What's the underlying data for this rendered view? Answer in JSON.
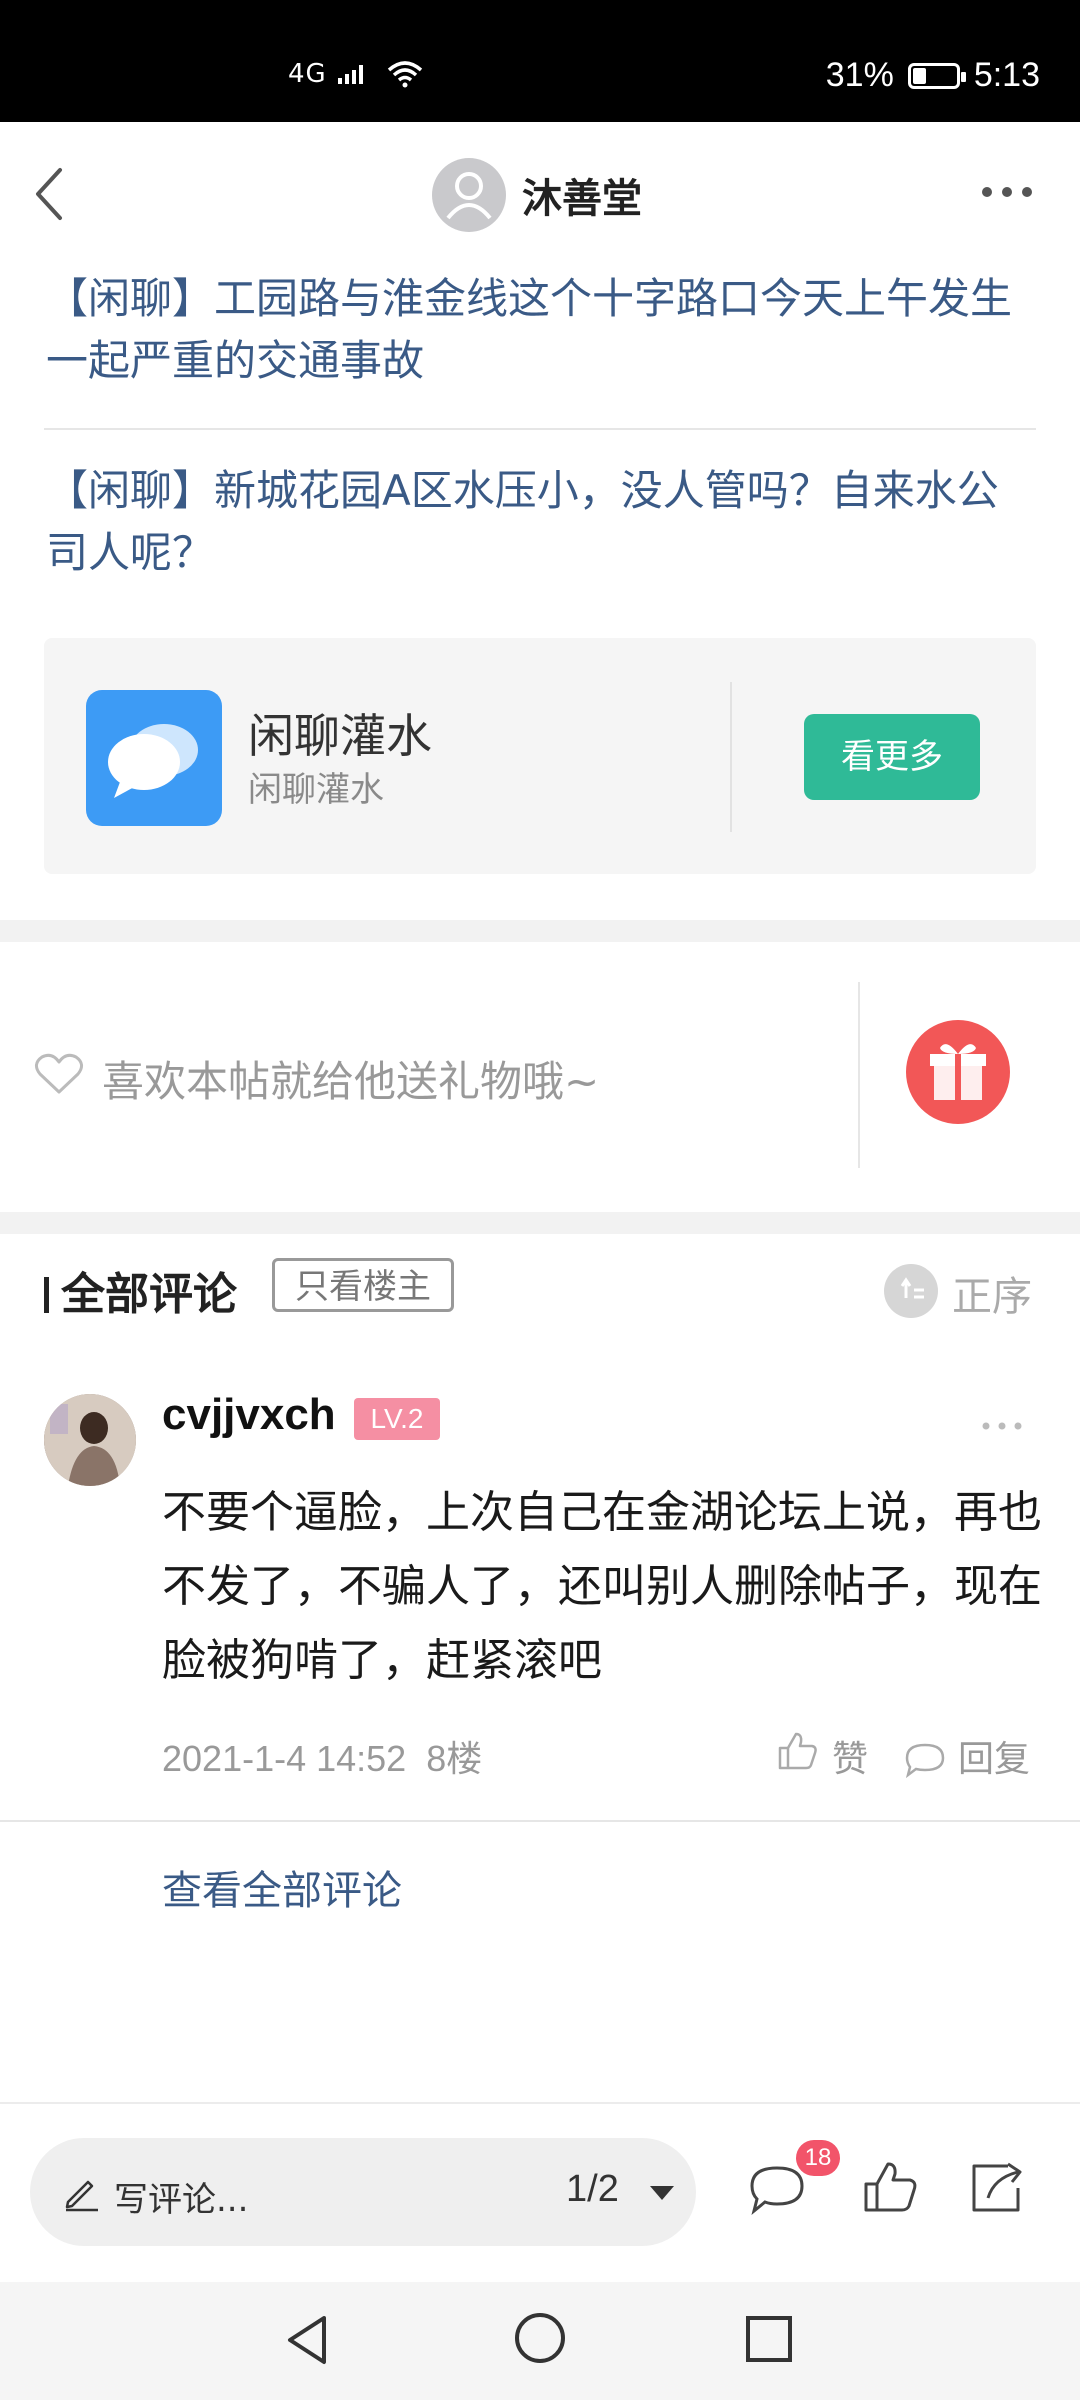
{
  "status_bar": {
    "network": "4G",
    "battery": "31%",
    "battery_level": 0.31,
    "time": "5:13"
  },
  "header": {
    "title": "沐善堂",
    "back_icon": "chevron-left-icon",
    "more_icon": "more-horizontal-icon"
  },
  "related_posts": [
    "【闲聊】工园路与淮金线这个十字路口今天上午发生一起严重的交通事故",
    "【闲聊】新城花园A区水压小，没人管吗？自来水公司人呢？"
  ],
  "forum_card": {
    "title": "闲聊灌水",
    "subtitle": "闲聊灌水",
    "button": "看更多",
    "icon": "chat-bubbles-icon",
    "accent": "#2fba97"
  },
  "gift": {
    "prompt": "喜欢本帖就给他送礼物哦~",
    "icon": "gift-icon"
  },
  "comments": {
    "title": "全部评论",
    "filter": "只看楼主",
    "sort": "正序",
    "items": [
      {
        "user": "cvjjvxch",
        "level": "LV.2",
        "text": "不要个逼脸，上次自己在金湖论坛上说，再也不发了，不骗人了，还叫别人删除帖子，现在脸被狗啃了，赶紧滚吧",
        "time": "2021-1-4 14:52",
        "floor": "8楼",
        "like_label": "赞",
        "reply_label": "回复"
      }
    ],
    "view_all": "查看全部评论"
  },
  "bottom_bar": {
    "placeholder": "写评论...",
    "page": "1/2",
    "comment_count": "18"
  },
  "colors": {
    "link": "#3a5a86",
    "accent_green": "#2fba97",
    "gift_red": "#f25757",
    "badge_pink": "#f58fa3"
  }
}
